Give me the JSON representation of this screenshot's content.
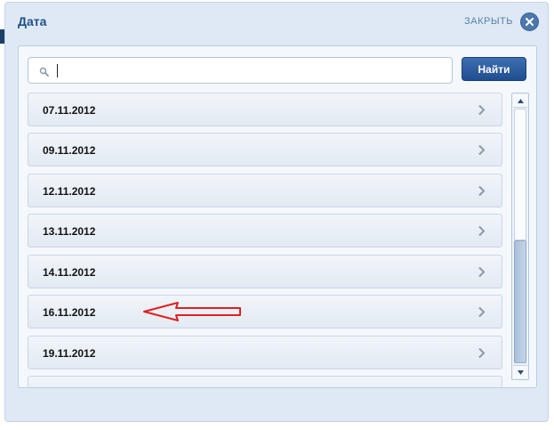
{
  "dialog": {
    "title": "Дата",
    "close_label": "ЗАКРЫТЬ"
  },
  "search": {
    "value": "",
    "placeholder": "",
    "button_label": "Найти"
  },
  "dates": [
    {
      "label": "07.11.2012"
    },
    {
      "label": "09.11.2012"
    },
    {
      "label": "12.11.2012"
    },
    {
      "label": "13.11.2012"
    },
    {
      "label": "14.11.2012"
    },
    {
      "label": "16.11.2012"
    },
    {
      "label": "19.11.2012"
    },
    {
      "label": ""
    }
  ],
  "scroll_position": 0.9,
  "colors": {
    "accent": "#1f4e86",
    "button": "#2a5a9e",
    "annotation_arrow": "#e0201f"
  },
  "icons": {
    "close": "close-icon",
    "search": "search-icon",
    "row": "chevron-right-icon"
  }
}
